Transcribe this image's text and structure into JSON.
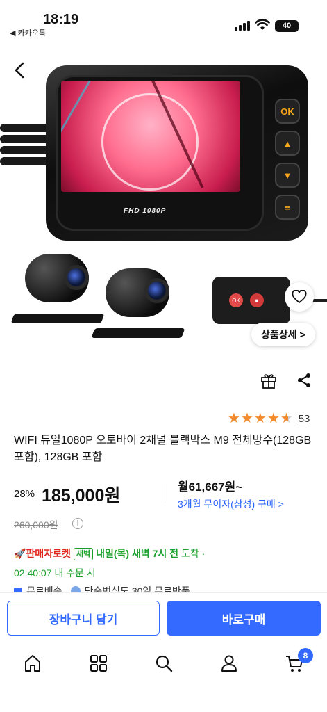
{
  "status_bar": {
    "time": "18:19",
    "back_app": "◀ 카카오톡",
    "battery": "40"
  },
  "hero": {
    "screen_label": "FHD 1080P",
    "ok_label": "OK",
    "remote_ok": "OK",
    "detail_button": "상품상세 >"
  },
  "rating": {
    "stars": 4.5,
    "review_count": "53"
  },
  "product": {
    "title": "WIFI 듀얼1080P 오토바이 2채널 블랙박스 M9 전체방수(128GB 포함), 128GB 포함"
  },
  "price": {
    "discount": "28%",
    "sale_price": "185,000원",
    "original_price": "260,000원",
    "monthly": "월61,667원~",
    "installment": "3개월 무이자(삼성) 구매 >"
  },
  "delivery": {
    "rocket_label": "🚀판매자로켓",
    "badge": "새벽",
    "arrive": "내일(목) 새벽 7시 전",
    "arrive_suffix": " 도착 ·",
    "cutoff": "02:40:07 내 주문 시",
    "free_shipping": "무료배송",
    "free_return": "단순변심도 30일 무료반품"
  },
  "buy_bar": {
    "cart_label": "장바구니 담기",
    "buy_label": "바로구매"
  },
  "tab_bar": {
    "cart_count": "8"
  },
  "colors": {
    "accent": "#346aff",
    "rocket": "#e1261c",
    "delivery_green": "#19a02b",
    "star": "#f28b2d"
  }
}
